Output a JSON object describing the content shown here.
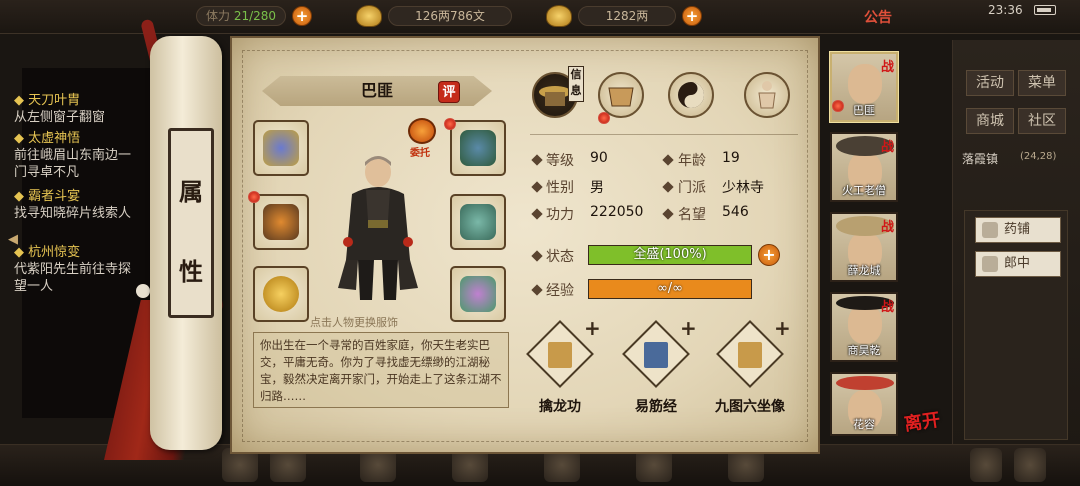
{
  "topbar": {
    "count_label": "体力",
    "count_value": "21/280",
    "money": "126两786文",
    "gold": "1282两",
    "notice": "公告",
    "clock": "23:36"
  },
  "quests": [
    {
      "title": "天刀叶胄",
      "desc": "从左侧窗子翻窗"
    },
    {
      "title": "太虚神悟",
      "desc": "前往峨眉山东南边一门寻卓不凡"
    },
    {
      "title": "霸者斗宴",
      "desc": "找寻知晓碎片线索人"
    },
    {
      "title": "杭州惊变",
      "desc": "代紫阳先生前往寺探望一人"
    }
  ],
  "scroll_title": [
    "属",
    "性"
  ],
  "character": {
    "name": "巴匪",
    "rate_badge": "评",
    "entrust_label": "委托",
    "hint": "点击人物更换服饰",
    "story": "你出生在一个寻常的百姓家庭，你天生老实巴交，平庸无奇。你为了寻找虚无缥缈的江湖秘宝，毅然决定离开家门，开始走上了这条江湖不归路……"
  },
  "tabs": {
    "selected_tag": "信息",
    "items": [
      "info-icon",
      "bag-icon",
      "taiji-icon",
      "body-icon"
    ]
  },
  "stats": {
    "level_label": "等级",
    "level": "90",
    "age_label": "年龄",
    "age": "19",
    "gender_label": "性别",
    "gender": "男",
    "sect_label": "门派",
    "sect": "少林寺",
    "power_label": "功力",
    "power": "222050",
    "fame_label": "名望",
    "fame": "546",
    "state_label": "状态",
    "state_text": "全盛(100%)",
    "state_ratio": 1.0,
    "exp_label": "经验",
    "exp_text": "∞/∞",
    "exp_ratio": 1.0
  },
  "colors": {
    "state_bar": "#7fbf2a",
    "exp_bar": "#e98a1c",
    "accent_red": "#c52b1a"
  },
  "skills": [
    {
      "name": "擒龙功",
      "plus": "+"
    },
    {
      "name": "易筋经",
      "plus": "+"
    },
    {
      "name": "九图六坐像",
      "plus": "+"
    }
  ],
  "team": [
    {
      "name": "巴匪",
      "tag": "战"
    },
    {
      "name": "火工老僧",
      "tag": "战"
    },
    {
      "name": "薛龙城",
      "tag": "战"
    },
    {
      "name": "商昊乾",
      "tag": "战"
    },
    {
      "name": "花容",
      "tag": ""
    }
  ],
  "right_menu": {
    "activity": "活动",
    "menu": "菜单",
    "shop": "商城",
    "community": "社区",
    "location": "落霞镇",
    "coords": "(24,28)",
    "list": [
      "药铺",
      "郎中"
    ]
  },
  "leave_label": "离开"
}
